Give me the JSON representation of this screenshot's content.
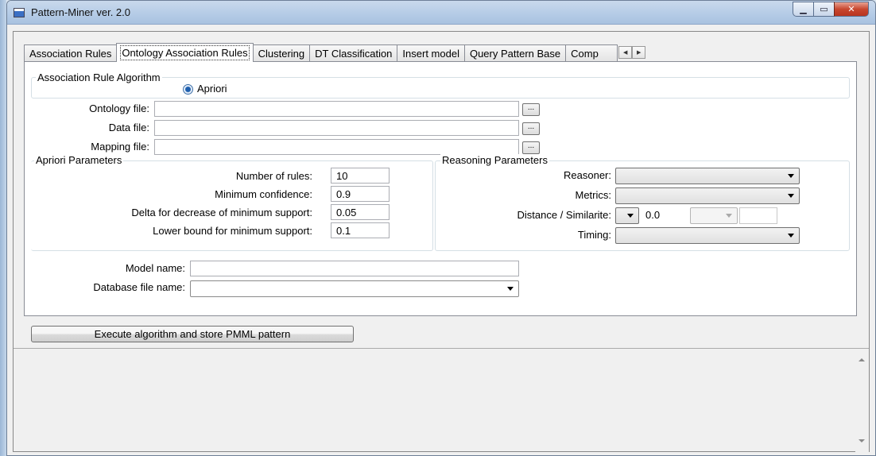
{
  "window": {
    "title": "Pattern-Miner ver. 2.0"
  },
  "tabs": [
    {
      "label": "Association Rules"
    },
    {
      "label": "Ontology Association Rules"
    },
    {
      "label": "Clustering"
    },
    {
      "label": "DT Classification"
    },
    {
      "label": "Insert model"
    },
    {
      "label": "Query Pattern Base"
    },
    {
      "label": "Comp"
    }
  ],
  "algorithm": {
    "group_label": "Association Rule Algorithm",
    "option": "Apriori",
    "selected": true
  },
  "files": {
    "ontology_label": "Ontology file:",
    "ontology_value": "",
    "data_label": "Data file:",
    "data_value": "",
    "mapping_label": "Mapping file:",
    "mapping_value": "",
    "browse_label": "..."
  },
  "apriori": {
    "group_label": "Apriori Parameters",
    "num_rules_label": "Number of rules:",
    "num_rules": "10",
    "min_conf_label": "Minimum confidence:",
    "min_conf": "0.9",
    "delta_label": "Delta for decrease of minimum support:",
    "delta": "0.05",
    "lower_bound_label": "Lower bound for minimum support:",
    "lower_bound": "0.1"
  },
  "reasoning": {
    "group_label": "Reasoning Parameters",
    "reasoner_label": "Reasoner:",
    "reasoner_value": "",
    "metrics_label": "Metrics:",
    "metrics_value": "",
    "distance_label": "Distance / Similarite:",
    "distance_value": "0.0",
    "timing_label": "Timing:",
    "timing_value": ""
  },
  "model": {
    "name_label": "Model name:",
    "name_value": "",
    "db_label": "Database file name:",
    "db_value": ""
  },
  "actions": {
    "execute_label": "Execute algorithm and store PMML pattern"
  },
  "output": {
    "text": ""
  }
}
